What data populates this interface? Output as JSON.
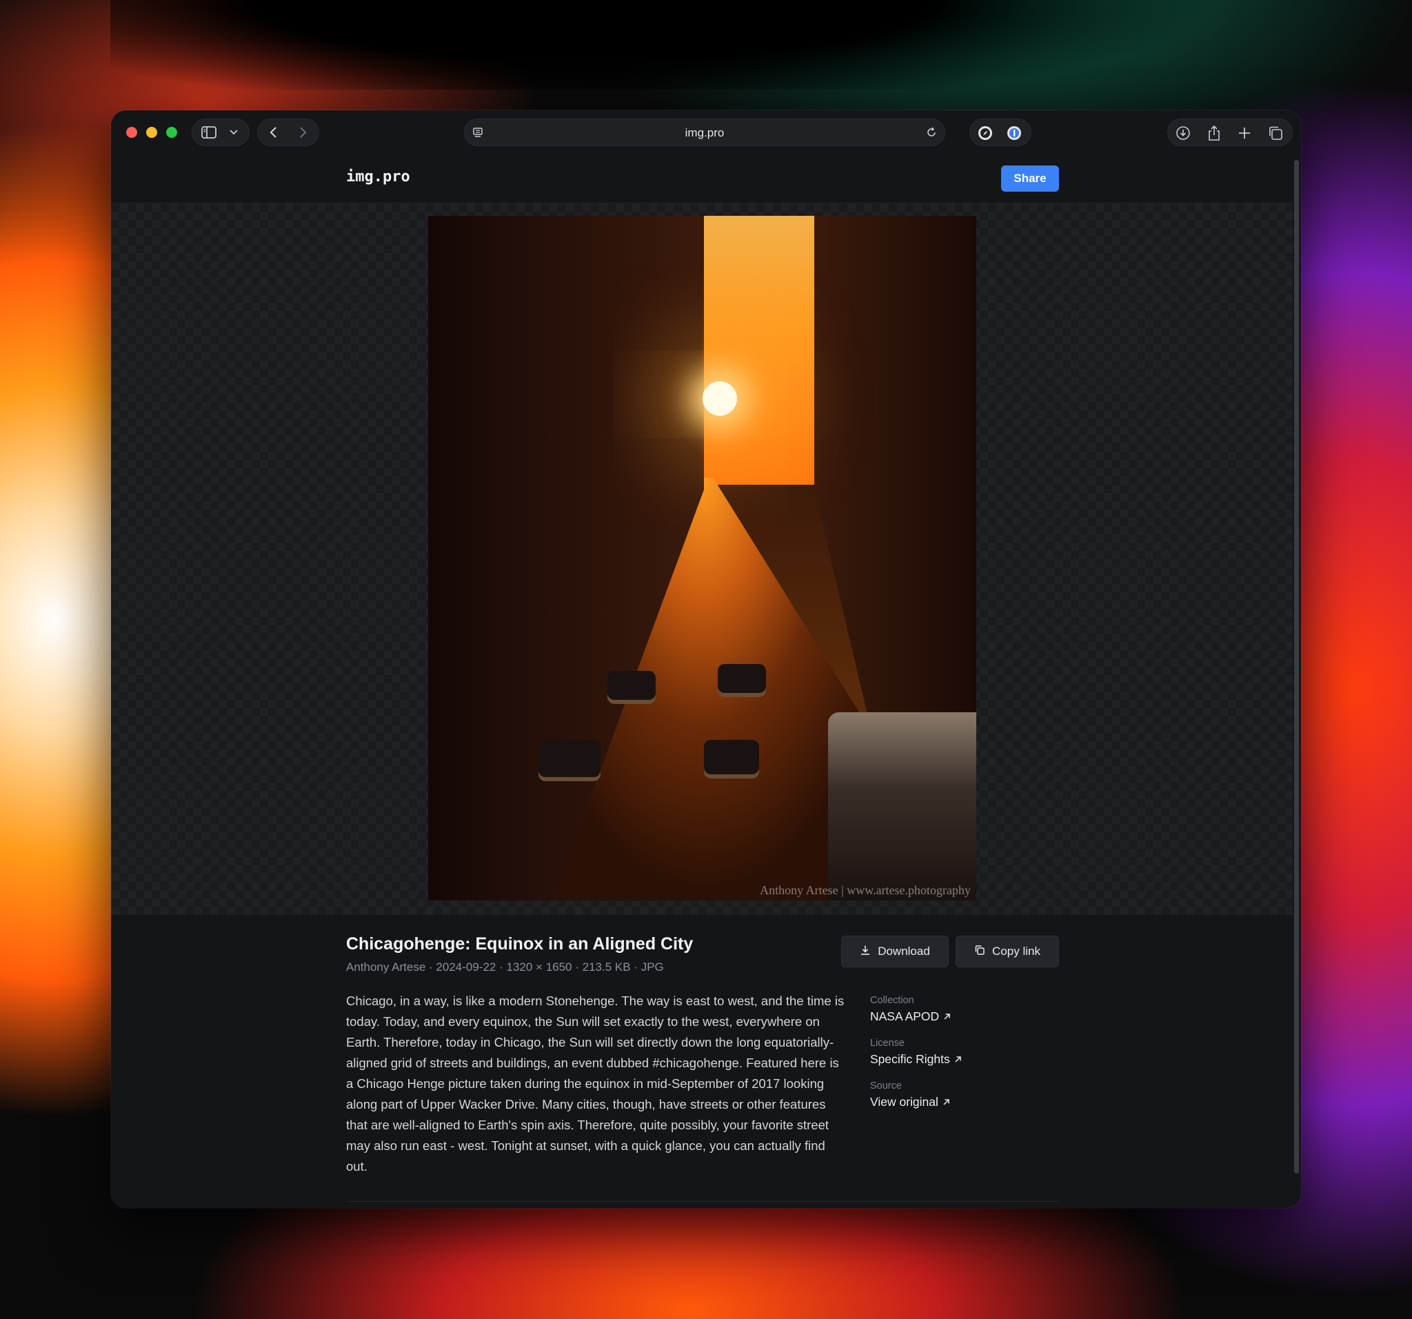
{
  "browser": {
    "address": "img.pro"
  },
  "header": {
    "logo": "img.pro",
    "share_label": "Share"
  },
  "image": {
    "watermark": "Anthony Artese | www.artese.photography"
  },
  "details": {
    "title": "Chicagohenge: Equinox in an Aligned City",
    "meta": {
      "author": "Anthony Artese",
      "date": "2024-09-22",
      "dimensions": "1320 × 1650",
      "size": "213.5 KB",
      "format": "JPG",
      "separator": " · "
    },
    "download_label": "Download",
    "copy_link_label": "Copy link",
    "description": "Chicago, in a way, is like a modern Stonehenge. The way is east to west, and the time is today. Today, and every equinox, the Sun will set exactly to the west, everywhere on Earth. Therefore, today in Chicago, the Sun will set directly down the long equatorially-aligned grid of streets and buildings, an event dubbed #chicagohenge. Featured here is a Chicago Henge picture taken during the equinox in mid-September of 2017 looking along part of Upper Wacker Drive. Many cities, though, have streets or other features that are well-aligned to Earth's spin axis. Therefore, quite possibly, your favorite street may also run east - west. Tonight at sunset, with a quick glance, you can actually find out.",
    "sidebar": {
      "collection_label": "Collection",
      "collection_value": "NASA APOD",
      "license_label": "License",
      "license_value": "Specific Rights",
      "source_label": "Source",
      "source_value": "View original"
    }
  },
  "icons": {
    "sidebar": "sidebar-icon",
    "chevron": "chevron-down-icon",
    "back": "back-icon",
    "forward": "forward-icon",
    "reader": "reader-icon",
    "reload": "reload-icon",
    "extension1": "compass-extension-icon",
    "extension2": "password-extension-icon",
    "downloads": "downloads-icon",
    "share": "share-icon",
    "new_tab": "new-tab-icon",
    "tabs": "tab-overview-icon",
    "external": "external-link-icon"
  },
  "colors": {
    "accent": "#3b82f6",
    "background": "#141518"
  }
}
